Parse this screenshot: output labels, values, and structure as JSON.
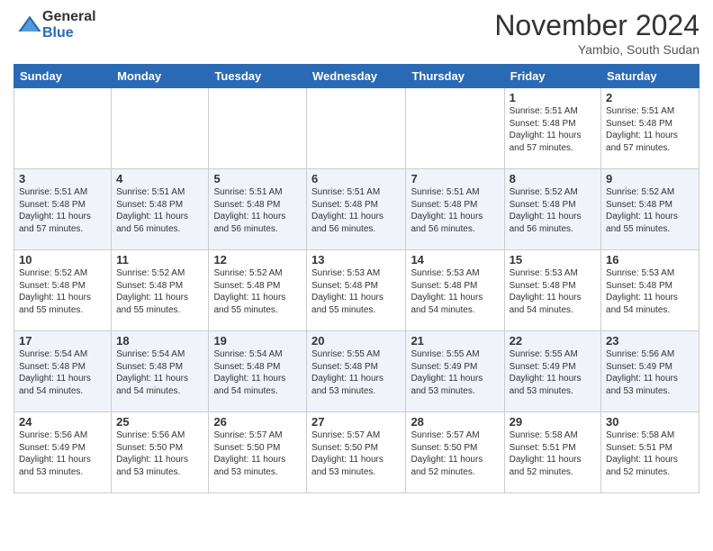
{
  "header": {
    "logo": {
      "general": "General",
      "blue": "Blue"
    },
    "title": "November 2024",
    "location": "Yambio, South Sudan"
  },
  "weekdays": [
    "Sunday",
    "Monday",
    "Tuesday",
    "Wednesday",
    "Thursday",
    "Friday",
    "Saturday"
  ],
  "weeks": [
    [
      {
        "day": "",
        "info": ""
      },
      {
        "day": "",
        "info": ""
      },
      {
        "day": "",
        "info": ""
      },
      {
        "day": "",
        "info": ""
      },
      {
        "day": "",
        "info": ""
      },
      {
        "day": "1",
        "info": "Sunrise: 5:51 AM\nSunset: 5:48 PM\nDaylight: 11 hours\nand 57 minutes."
      },
      {
        "day": "2",
        "info": "Sunrise: 5:51 AM\nSunset: 5:48 PM\nDaylight: 11 hours\nand 57 minutes."
      }
    ],
    [
      {
        "day": "3",
        "info": "Sunrise: 5:51 AM\nSunset: 5:48 PM\nDaylight: 11 hours\nand 57 minutes."
      },
      {
        "day": "4",
        "info": "Sunrise: 5:51 AM\nSunset: 5:48 PM\nDaylight: 11 hours\nand 56 minutes."
      },
      {
        "day": "5",
        "info": "Sunrise: 5:51 AM\nSunset: 5:48 PM\nDaylight: 11 hours\nand 56 minutes."
      },
      {
        "day": "6",
        "info": "Sunrise: 5:51 AM\nSunset: 5:48 PM\nDaylight: 11 hours\nand 56 minutes."
      },
      {
        "day": "7",
        "info": "Sunrise: 5:51 AM\nSunset: 5:48 PM\nDaylight: 11 hours\nand 56 minutes."
      },
      {
        "day": "8",
        "info": "Sunrise: 5:52 AM\nSunset: 5:48 PM\nDaylight: 11 hours\nand 56 minutes."
      },
      {
        "day": "9",
        "info": "Sunrise: 5:52 AM\nSunset: 5:48 PM\nDaylight: 11 hours\nand 55 minutes."
      }
    ],
    [
      {
        "day": "10",
        "info": "Sunrise: 5:52 AM\nSunset: 5:48 PM\nDaylight: 11 hours\nand 55 minutes."
      },
      {
        "day": "11",
        "info": "Sunrise: 5:52 AM\nSunset: 5:48 PM\nDaylight: 11 hours\nand 55 minutes."
      },
      {
        "day": "12",
        "info": "Sunrise: 5:52 AM\nSunset: 5:48 PM\nDaylight: 11 hours\nand 55 minutes."
      },
      {
        "day": "13",
        "info": "Sunrise: 5:53 AM\nSunset: 5:48 PM\nDaylight: 11 hours\nand 55 minutes."
      },
      {
        "day": "14",
        "info": "Sunrise: 5:53 AM\nSunset: 5:48 PM\nDaylight: 11 hours\nand 54 minutes."
      },
      {
        "day": "15",
        "info": "Sunrise: 5:53 AM\nSunset: 5:48 PM\nDaylight: 11 hours\nand 54 minutes."
      },
      {
        "day": "16",
        "info": "Sunrise: 5:53 AM\nSunset: 5:48 PM\nDaylight: 11 hours\nand 54 minutes."
      }
    ],
    [
      {
        "day": "17",
        "info": "Sunrise: 5:54 AM\nSunset: 5:48 PM\nDaylight: 11 hours\nand 54 minutes."
      },
      {
        "day": "18",
        "info": "Sunrise: 5:54 AM\nSunset: 5:48 PM\nDaylight: 11 hours\nand 54 minutes."
      },
      {
        "day": "19",
        "info": "Sunrise: 5:54 AM\nSunset: 5:48 PM\nDaylight: 11 hours\nand 54 minutes."
      },
      {
        "day": "20",
        "info": "Sunrise: 5:55 AM\nSunset: 5:48 PM\nDaylight: 11 hours\nand 53 minutes."
      },
      {
        "day": "21",
        "info": "Sunrise: 5:55 AM\nSunset: 5:49 PM\nDaylight: 11 hours\nand 53 minutes."
      },
      {
        "day": "22",
        "info": "Sunrise: 5:55 AM\nSunset: 5:49 PM\nDaylight: 11 hours\nand 53 minutes."
      },
      {
        "day": "23",
        "info": "Sunrise: 5:56 AM\nSunset: 5:49 PM\nDaylight: 11 hours\nand 53 minutes."
      }
    ],
    [
      {
        "day": "24",
        "info": "Sunrise: 5:56 AM\nSunset: 5:49 PM\nDaylight: 11 hours\nand 53 minutes."
      },
      {
        "day": "25",
        "info": "Sunrise: 5:56 AM\nSunset: 5:50 PM\nDaylight: 11 hours\nand 53 minutes."
      },
      {
        "day": "26",
        "info": "Sunrise: 5:57 AM\nSunset: 5:50 PM\nDaylight: 11 hours\nand 53 minutes."
      },
      {
        "day": "27",
        "info": "Sunrise: 5:57 AM\nSunset: 5:50 PM\nDaylight: 11 hours\nand 53 minutes."
      },
      {
        "day": "28",
        "info": "Sunrise: 5:57 AM\nSunset: 5:50 PM\nDaylight: 11 hours\nand 52 minutes."
      },
      {
        "day": "29",
        "info": "Sunrise: 5:58 AM\nSunset: 5:51 PM\nDaylight: 11 hours\nand 52 minutes."
      },
      {
        "day": "30",
        "info": "Sunrise: 5:58 AM\nSunset: 5:51 PM\nDaylight: 11 hours\nand 52 minutes."
      }
    ]
  ]
}
